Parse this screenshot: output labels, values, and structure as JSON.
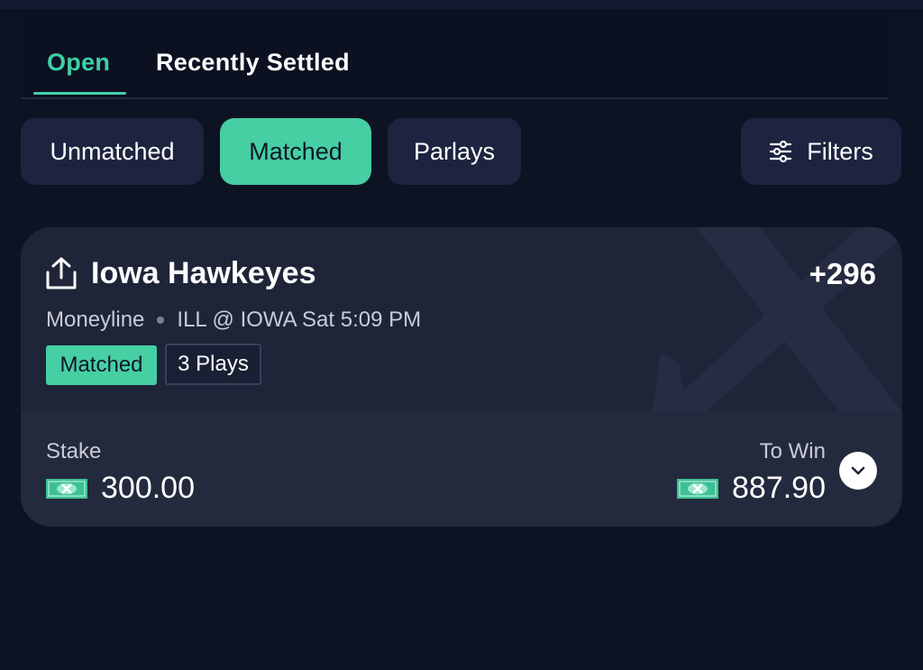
{
  "tabs": {
    "open_label": "Open",
    "settled_label": "Recently Settled"
  },
  "filter_chips": {
    "unmatched_label": "Unmatched",
    "matched_label": "Matched",
    "parlays_label": "Parlays",
    "filters_label": "Filters",
    "active": "Matched"
  },
  "bet_card": {
    "team": "Iowa Hawkeyes",
    "odds": "+296",
    "market": "Moneyline",
    "game": "ILL @ IOWA Sat 5:09 PM",
    "status_badge": "Matched",
    "plays_badge": "3 Plays",
    "stake_label": "Stake",
    "stake_amount": "300.00",
    "to_win_label": "To Win",
    "to_win_amount": "887.90"
  },
  "icons": {
    "share": "share-upload-icon",
    "filters": "sliders-icon",
    "money": "cash-icon",
    "expand": "chevron-down-icon"
  },
  "colors": {
    "accent": "#46cfa3",
    "tab_active": "#3fd0a4",
    "background": "#0e1324",
    "card": "#1f2539",
    "chip": "#1d2440"
  }
}
